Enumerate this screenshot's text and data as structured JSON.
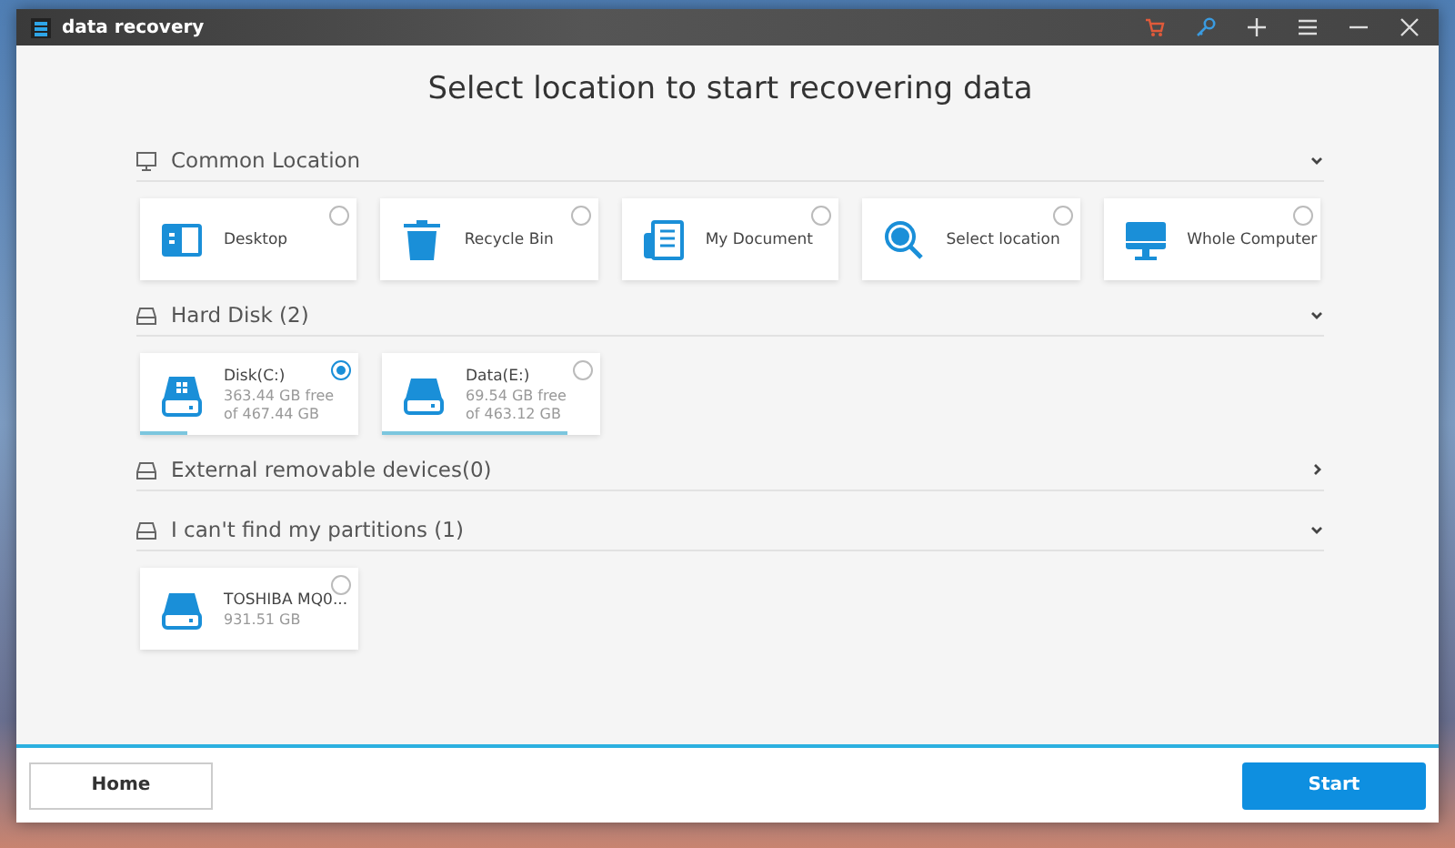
{
  "window": {
    "title": "data recovery"
  },
  "title_bar_buttons": [
    {
      "kind": "cart"
    },
    {
      "kind": "key"
    },
    {
      "kind": "plus"
    },
    {
      "kind": "menu"
    },
    {
      "kind": "minimize"
    },
    {
      "kind": "close"
    }
  ],
  "heading": "Select location to start recovering data",
  "sections": [
    {
      "title": "Common Location",
      "expanded": true,
      "items": [
        {
          "kind": "location",
          "label": "Desktop",
          "selected": false
        },
        {
          "kind": "location",
          "label": "Recycle Bin",
          "selected": false
        },
        {
          "kind": "location",
          "label": "My Document",
          "selected": false
        },
        {
          "kind": "location",
          "label": "Select location",
          "selected": false
        },
        {
          "kind": "location",
          "label": "Whole Computer",
          "selected": false
        }
      ]
    },
    {
      "title": "Hard Disk (2)",
      "expanded": true,
      "items": [
        {
          "kind": "disk",
          "label": "Disk(C:)",
          "free": "363.44 GB  free",
          "total": "of  467.44 GB",
          "level": 0.22,
          "selected": true
        },
        {
          "kind": "disk",
          "label": "Data(E:)",
          "free": "69.54 GB  free",
          "total": "of  463.12 GB",
          "level": 0.85,
          "selected": false
        }
      ]
    },
    {
      "title": "External removable devices(0)",
      "expanded": false
    },
    {
      "title": "I can't find my partitions (1)",
      "expanded": true,
      "items": [
        {
          "kind": "partition",
          "label": "TOSHIBA MQ0...",
          "size": "931.51 GB",
          "selected": false
        }
      ]
    }
  ],
  "footer": {
    "home": "Home",
    "start": "Start"
  }
}
